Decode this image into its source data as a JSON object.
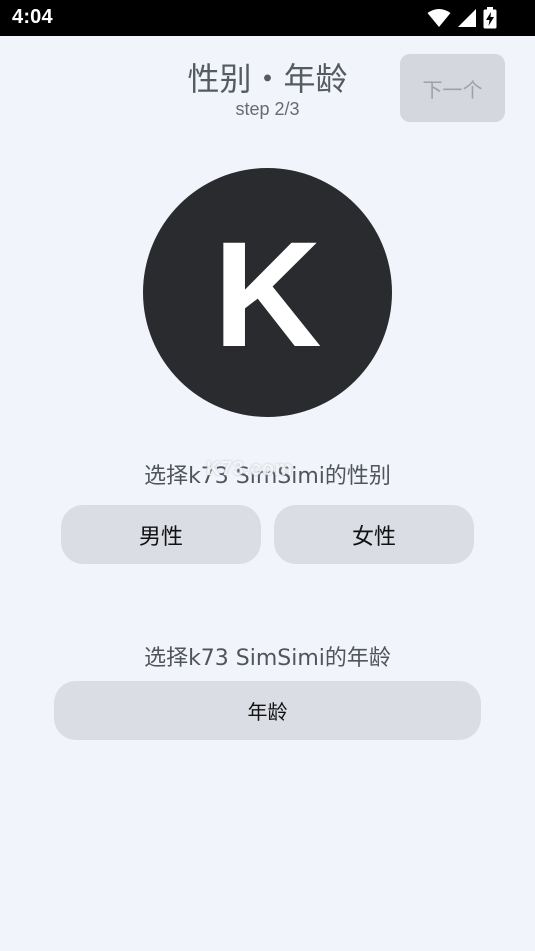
{
  "status_bar": {
    "time": "4:04",
    "icons": [
      "wifi-icon",
      "signal-icon",
      "battery-charging-icon"
    ]
  },
  "header": {
    "title": "性别・年龄",
    "step": "step 2/3",
    "next_label": "下一个"
  },
  "avatar": {
    "letter": "K"
  },
  "gender_section": {
    "label": "选择k73 SimSimi的性别",
    "male_label": "男性",
    "female_label": "女性"
  },
  "age_section": {
    "label": "选择k73 SimSimi的年龄",
    "age_button_label": "年龄"
  },
  "watermark": {
    "text": "K73.com"
  },
  "colors": {
    "background": "#f2f4fb",
    "avatar_bg": "#2a2b2f",
    "pill_bg": "#dadde4",
    "disabled_button_bg": "#d4d7dd"
  }
}
